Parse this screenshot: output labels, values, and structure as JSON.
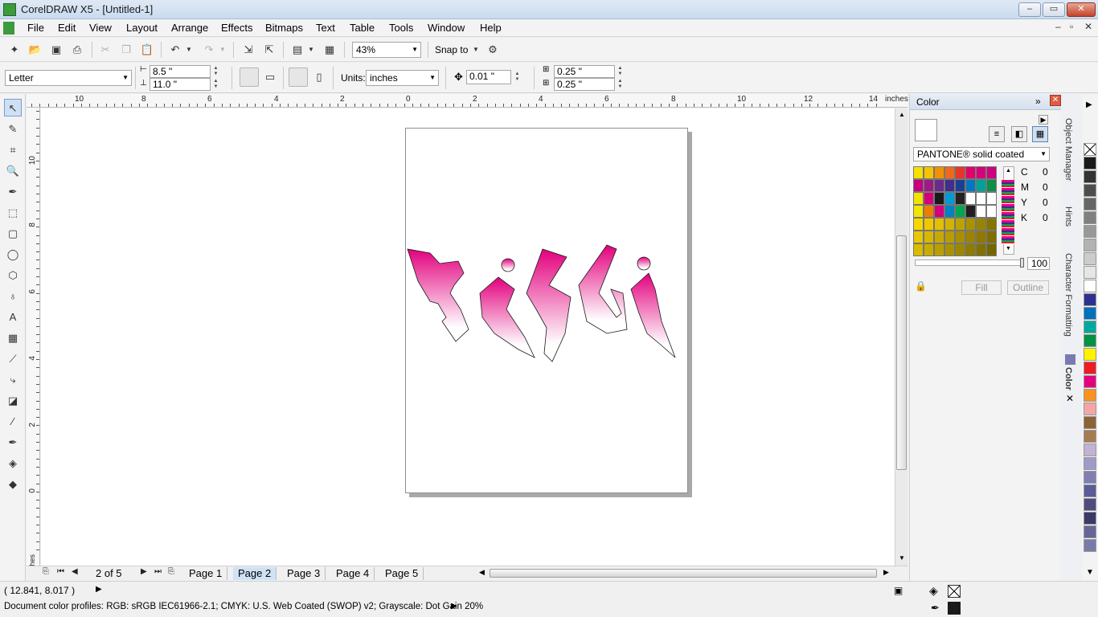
{
  "window": {
    "title": "CorelDRAW X5 - [Untitled-1]"
  },
  "menu": [
    "File",
    "Edit",
    "View",
    "Layout",
    "Arrange",
    "Effects",
    "Bitmaps",
    "Text",
    "Table",
    "Tools",
    "Window",
    "Help"
  ],
  "toolbar": {
    "zoom": "43%",
    "snap_label": "Snap to"
  },
  "property_bar": {
    "paper_size": "Letter",
    "width": "8.5 \"",
    "height": "11.0 \"",
    "units_label": "Units:",
    "units": "inches",
    "nudge": "0.01 \"",
    "dup_x": "0.25 \"",
    "dup_y": "0.25 \""
  },
  "ruler": {
    "units": "inches",
    "h_labels": [
      "10",
      "8",
      "6",
      "4",
      "2",
      "0",
      "2",
      "4",
      "6",
      "8",
      "10",
      "12",
      "14"
    ],
    "v_labels": [
      "10",
      "8",
      "6",
      "4",
      "2",
      "0"
    ],
    "v_units": "inches"
  },
  "artwork": {
    "text": "RISKI",
    "colors": {
      "top": "#e3007d",
      "bottom": "#ffffff"
    }
  },
  "page_nav": {
    "counter": "2 of 5",
    "pages": [
      "Page 1",
      "Page 2",
      "Page 3",
      "Page 4",
      "Page 5"
    ],
    "active_index": 1
  },
  "status": {
    "coords": "( 12.841, 8.017 )",
    "color_profiles": "Document color profiles: RGB: sRGB IEC61966-2.1; CMYK: U.S. Web Coated (SWOP) v2; Grayscale: Dot Gain 20%"
  },
  "docker": {
    "title": "Color",
    "palette_name": "PANTONE® solid coated",
    "cmyk": [
      {
        "label": "C",
        "value": "0"
      },
      {
        "label": "M",
        "value": "0"
      },
      {
        "label": "Y",
        "value": "0"
      },
      {
        "label": "K",
        "value": "0"
      }
    ],
    "tint": "100",
    "fill_label": "Fill",
    "outline_label": "Outline",
    "side_tabs": [
      "Object Manager",
      "Hints",
      "Character Formatting",
      "Color"
    ]
  },
  "swatch_colors": [
    [
      "#f5e100",
      "#f5c400",
      "#f29100",
      "#ee6a1a",
      "#e8352a",
      "#e4006a",
      "#d4007a",
      "#cf007f"
    ],
    [
      "#c6007f",
      "#9b1b82",
      "#6a2b8a",
      "#402d8c",
      "#1c3f94",
      "#0078c1",
      "#00a19a",
      "#0b8f48"
    ],
    [
      "#f5e100",
      "#d4007a",
      "#1a1a1a",
      "#009ad6",
      "#222222",
      "#ffffff",
      "#ffffff",
      "#ffffff"
    ],
    [
      "#f2e500",
      "#ee7d00",
      "#d4007a",
      "#0083c1",
      "#00a650",
      "#1f1f1f",
      "#ffffff",
      "#ffffff"
    ],
    [
      "#f5d800",
      "#f0c800",
      "#e3c000",
      "#d1b300",
      "#bba300",
      "#a99200",
      "#988300",
      "#877400"
    ],
    [
      "#e8c800",
      "#d6b800",
      "#c7aa00",
      "#b89c00",
      "#a98f00",
      "#9c8300",
      "#8f7800",
      "#826d00"
    ],
    [
      "#d9bc00",
      "#c8ad00",
      "#b9a000",
      "#aa9300",
      "#9c8700",
      "#8f7b00",
      "#827000",
      "#766600"
    ]
  ],
  "palette_colors": [
    "#1a1a1a",
    "#333333",
    "#4d4d4d",
    "#666666",
    "#808080",
    "#999999",
    "#b3b3b3",
    "#cccccc",
    "#e6e6e6",
    "#ffffff",
    "#2e3192",
    "#0071bc",
    "#00a99d",
    "#009245",
    "#fff200",
    "#ed1c24",
    "#e6007e",
    "#f7931e",
    "#f4a6a6",
    "#8c6239",
    "#a67c52",
    "#c1b2d6",
    "#9e9bc9",
    "#7f7fb3",
    "#5c5c99",
    "#4d4d80",
    "#3a3a66",
    "#666699",
    "#7a7aa8"
  ]
}
